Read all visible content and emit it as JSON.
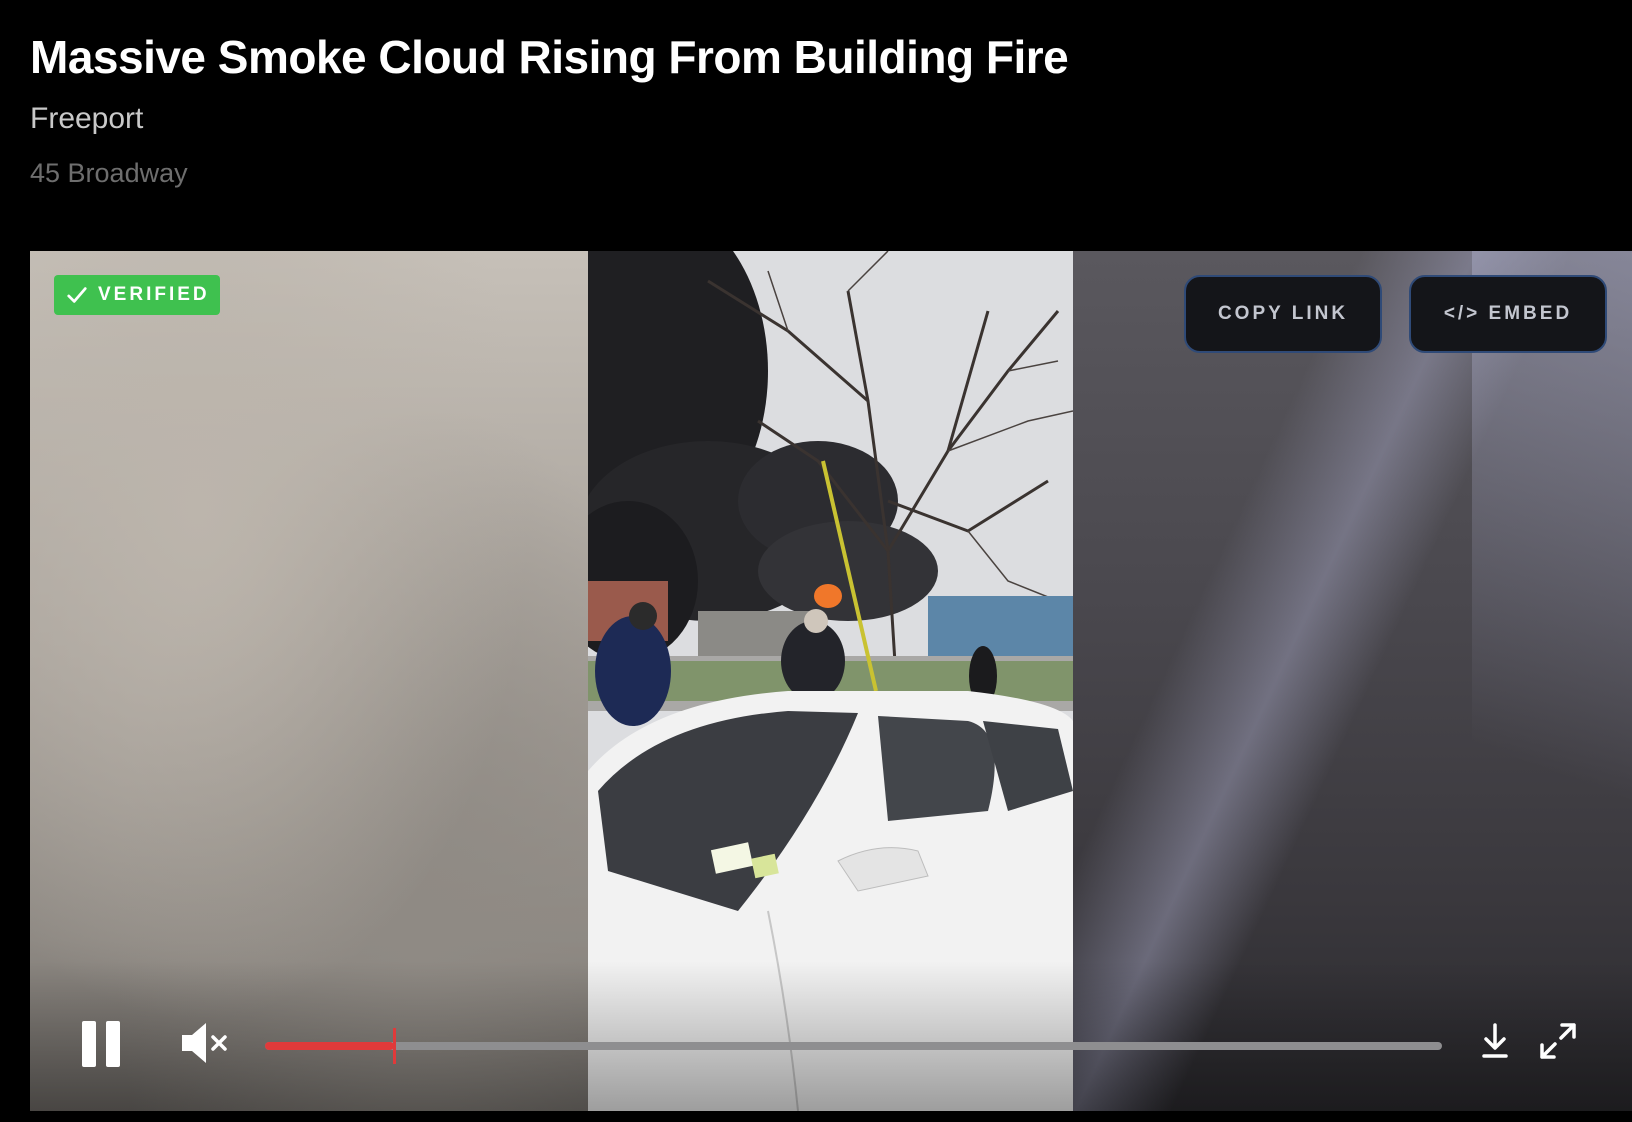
{
  "header": {
    "title": "Massive Smoke Cloud Rising From Building Fire",
    "city": "Freeport",
    "address": "45 Broadway"
  },
  "player": {
    "badge": {
      "label": "VERIFIED",
      "icon": "check-icon",
      "color": "#3fc14f"
    },
    "copy_link_label": "COPY LINK",
    "embed_label": "</> EMBED",
    "embed_icon": "code-icon",
    "controls": {
      "pause_icon": "pause-icon",
      "mute_icon": "muted-speaker-icon",
      "download_icon": "download-icon",
      "fullscreen_icon": "fullscreen-icon",
      "progress_fraction": 0.11,
      "progress_color": "#e03a3a"
    }
  }
}
